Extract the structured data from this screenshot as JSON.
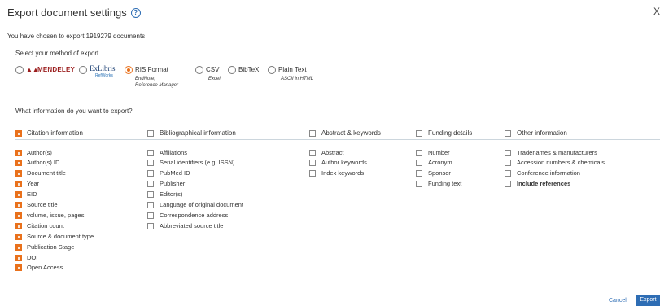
{
  "dialog": {
    "title": "Export document settings",
    "close_label": "X",
    "subtitle": "You have chosen to export 1919279 documents",
    "method_label": "Select your method of export",
    "info_label": "What information do you want to export?"
  },
  "methods": {
    "mendeley": "MENDELEY",
    "exlibris": "ExLibris",
    "refworks": "RefWorks",
    "ris": {
      "label": "RIS Format",
      "sub1": "EndNote,",
      "sub2": "Reference Manager"
    },
    "csv": {
      "label": "CSV",
      "sub": "Excel"
    },
    "bibtex": {
      "label": "BibTeX"
    },
    "plaintext": {
      "label": "Plain Text",
      "sub": "ASCII in HTML"
    }
  },
  "categories": {
    "citation": "Citation information",
    "bibliographical": "Bibliographical information",
    "abstract": "Abstract & keywords",
    "funding": "Funding details",
    "other": "Other information"
  },
  "citation_items": [
    "Author(s)",
    "Author(s) ID",
    "Document title",
    "Year",
    "EID",
    "Source title",
    "volume, issue, pages",
    "Citation count",
    "Source & document type",
    "Publication Stage",
    "DOI",
    "Open Access"
  ],
  "biblio_items": [
    "Affiliations",
    "Serial identifiers (e.g. ISSN)",
    "PubMed ID",
    "Publisher",
    "Editor(s)",
    "Language of original document",
    "Correspondence address",
    "Abbreviated source title"
  ],
  "abstract_items": [
    "Abstract",
    "Author keywords",
    "Index keywords"
  ],
  "funding_items": [
    "Number",
    "Acronym",
    "Sponsor",
    "Funding text"
  ],
  "other_items": [
    "Tradenames & manufacturers",
    "Accession numbers & chemicals",
    "Conference information",
    "Include references"
  ],
  "footer": {
    "cancel": "Cancel",
    "export": "Export"
  },
  "colors": {
    "accent": "#e9711c",
    "link": "#2e6db4",
    "mendeley": "#9a1c1c"
  }
}
